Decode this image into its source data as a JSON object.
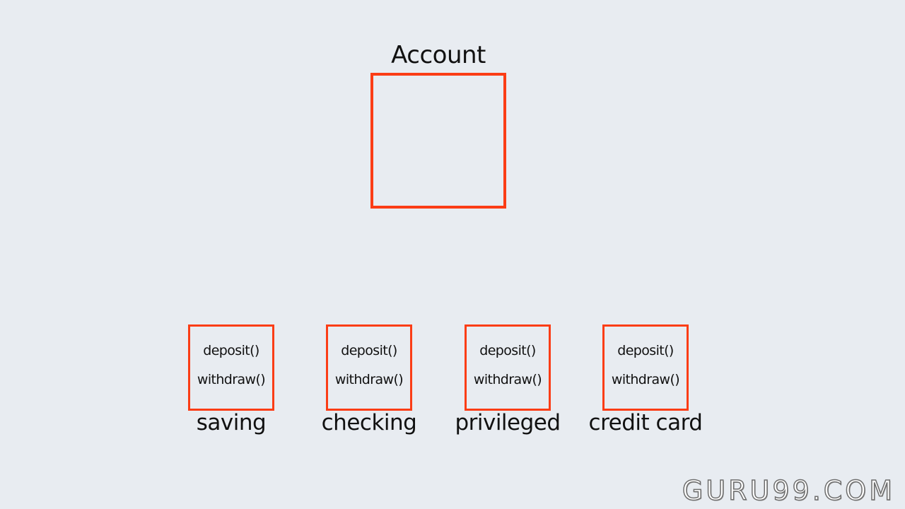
{
  "parent": {
    "title": "Account"
  },
  "children": [
    {
      "name": "saving",
      "methods": [
        "deposit()",
        "withdraw()"
      ]
    },
    {
      "name": "checking",
      "methods": [
        "deposit()",
        "withdraw()"
      ]
    },
    {
      "name": "privileged",
      "methods": [
        "deposit()",
        "withdraw()"
      ]
    },
    {
      "name": "credit card",
      "methods": [
        "deposit()",
        "withdraw()"
      ]
    }
  ],
  "watermark": "GURU99.COM",
  "colors": {
    "box_border": "#fb3d16",
    "background": "#e8ecf1",
    "text": "#111111"
  }
}
